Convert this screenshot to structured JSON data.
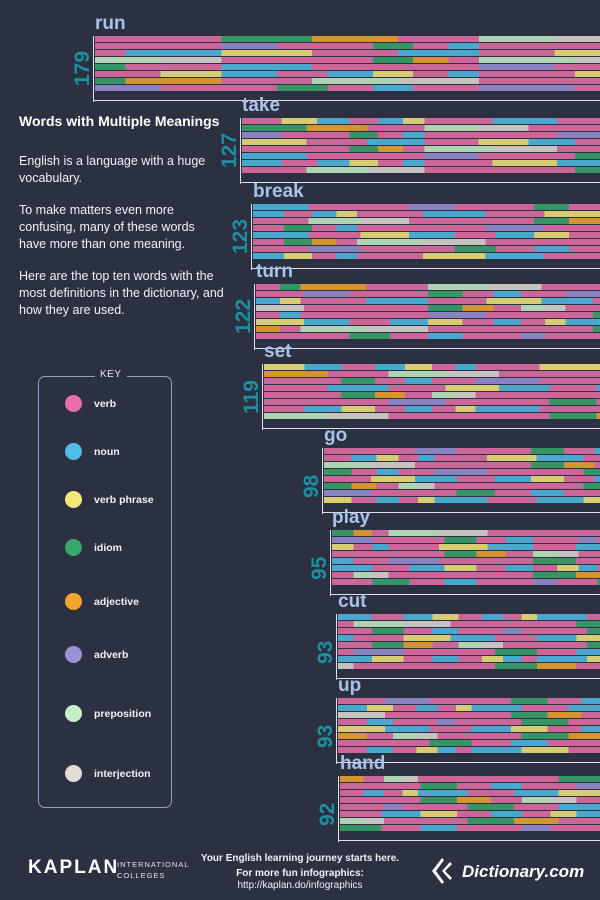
{
  "title": "Words with Multiple Meanings",
  "intro": [
    "English is a language with a huge vocabulary.",
    "To make matters even more confusing, many of these words have more than one meaning.",
    "Here are the top ten words with the most definitions in the dictionary, and how they are used."
  ],
  "key": {
    "title": "KEY",
    "items": [
      {
        "label": "verb",
        "color": "#e86fa8"
      },
      {
        "label": "noun",
        "color": "#4fbde8"
      },
      {
        "label": "verb phrase",
        "color": "#f5e87a"
      },
      {
        "label": "idiom",
        "color": "#39a66b"
      },
      {
        "label": "adjective",
        "color": "#f3a62a"
      },
      {
        "label": "adverb",
        "color": "#9b91d6"
      },
      {
        "label": "preposition",
        "color": "#c6f0c6"
      },
      {
        "label": "interjection",
        "color": "#e2dcd6"
      }
    ]
  },
  "chart_data": {
    "type": "bar",
    "categories": [
      "run",
      "take",
      "break",
      "turn",
      "set",
      "go",
      "play",
      "cut",
      "up",
      "hand"
    ],
    "values": [
      179,
      127,
      123,
      122,
      119,
      98,
      95,
      93,
      93,
      92
    ]
  },
  "footer": {
    "brand": "KAPLAN",
    "brand_sub1": "INTERNATIONAL",
    "brand_sub2": "COLLEGES",
    "line1": "Your English learning journey starts here.",
    "line2": "For more fun infographics:",
    "line3": "http://kaplan.do/infographics",
    "logo_text": "Dictionary.com"
  }
}
